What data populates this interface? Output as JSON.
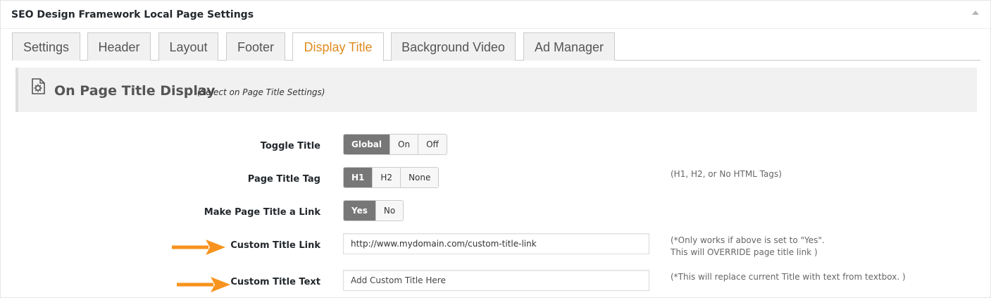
{
  "panel": {
    "title": "SEO Design Framework Local Page Settings"
  },
  "tabs": [
    {
      "label": "Settings"
    },
    {
      "label": "Header"
    },
    {
      "label": "Layout"
    },
    {
      "label": "Footer"
    },
    {
      "label": "Display Title",
      "active": true
    },
    {
      "label": "Background Video"
    },
    {
      "label": "Ad Manager"
    }
  ],
  "section": {
    "title": "On Page Title Display",
    "subtitle": "(Select on Page Title Settings)"
  },
  "fields": {
    "toggle_title": {
      "label": "Toggle Title",
      "options": [
        "Global",
        "On",
        "Off"
      ],
      "selected": "Global"
    },
    "page_title_tag": {
      "label": "Page Title Tag",
      "options": [
        "H1",
        "H2",
        "None"
      ],
      "selected": "H1",
      "hint": "(H1, H2, or No HTML Tags)"
    },
    "make_link": {
      "label": "Make Page Title a Link",
      "options": [
        "Yes",
        "No"
      ],
      "selected": "Yes"
    },
    "custom_title_link": {
      "label": "Custom Title Link",
      "value": "http://www.mydomain.com/custom-title-link",
      "hint_line1": "(*Only works if above is set to \"Yes\".",
      "hint_line2": "This will OVERRIDE page title link )"
    },
    "custom_title_text": {
      "label": "Custom Title Text",
      "placeholder": "Add Custom Title Here",
      "hint": "(*This will replace current Title with text from textbox. )"
    }
  },
  "colors": {
    "accent": "#e08a1e",
    "arrow": "#f7931e",
    "selected_button": "#777777"
  },
  "icons": [
    "collapse-arrow-up-icon",
    "page-settings-icon",
    "pointer-arrow-icon"
  ]
}
